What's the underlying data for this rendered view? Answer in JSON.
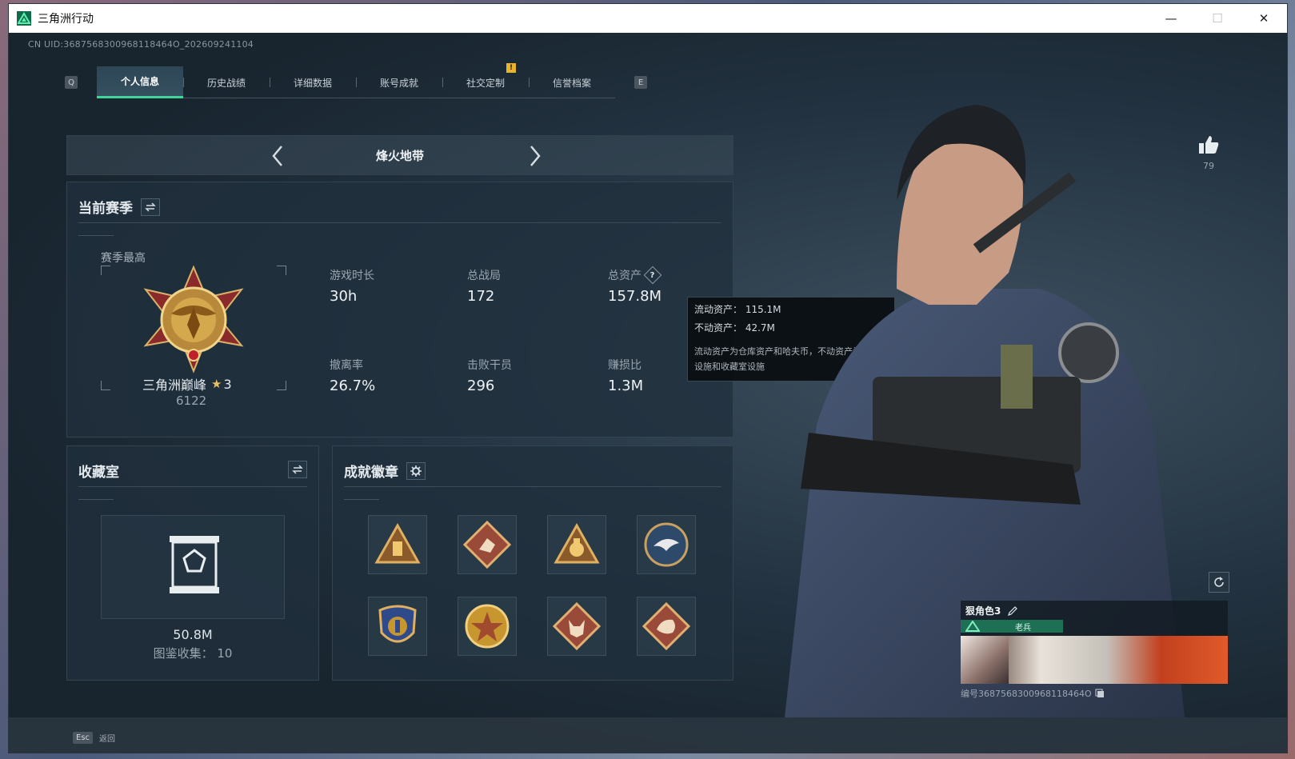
{
  "window": {
    "title": "三角洲行动",
    "minimize": "—",
    "maximize": "☐",
    "close": "✕"
  },
  "uid": "CN UID:3687568300968118464O_202609241104",
  "watermark": "",
  "tabs": {
    "prev_key": "Q",
    "next_key": "E",
    "badge": "!",
    "items": [
      {
        "label": "个人信息"
      },
      {
        "label": "历史战绩"
      },
      {
        "label": "详细数据"
      },
      {
        "label": "账号成就"
      },
      {
        "label": "社交定制"
      },
      {
        "label": "信誉档案"
      }
    ]
  },
  "mode": {
    "title": "烽火地带"
  },
  "season": {
    "title": "当前赛季",
    "best_label": "赛季最高",
    "rank_name": "三角洲巅峰",
    "rank_stars": "3",
    "rank_points": "6122",
    "stats": [
      {
        "label": "游戏时长",
        "value": "30h"
      },
      {
        "label": "总战局",
        "value": "172"
      },
      {
        "label": "总资产",
        "value": "157.8M"
      },
      {
        "label": "撤离率",
        "value": "26.7%"
      },
      {
        "label": "击败干员",
        "value": "296"
      },
      {
        "label": "赚损比",
        "value": "1.3M"
      }
    ]
  },
  "tooltip": {
    "liquid": "流动资产：  115.1M",
    "fixed": "不动资产：  42.7M",
    "desc": "流动资产为仓库资产和哈夫币，不动资产为特勤处设施和收藏室设施"
  },
  "collection": {
    "title": "收藏室",
    "value": "50.8M",
    "count": "图鉴收集：  10"
  },
  "badges": {
    "title": "成就徽章",
    "items": [
      {
        "icon": "triangle-vault-badge-icon",
        "color": "#8a5a2a"
      },
      {
        "icon": "runner-diamond-badge-icon",
        "color": "#9a4a38"
      },
      {
        "icon": "moneybag-triangle-badge-icon",
        "color": "#8a5a2a"
      },
      {
        "icon": "eagle-round-badge-icon",
        "color": "#2e4a6a"
      },
      {
        "icon": "police-shield-badge-icon",
        "color": "#2e4a8a"
      },
      {
        "icon": "star-medal-badge-icon",
        "color": "#a04a2e"
      },
      {
        "icon": "wolf-diamond-badge-icon",
        "color": "#9a4a38"
      },
      {
        "icon": "dragon-diamond-badge-icon",
        "color": "#9a4a38"
      }
    ]
  },
  "like": {
    "count": "79"
  },
  "namecard": {
    "name": "狠角色3",
    "rank": "老兵",
    "id": "编号3687568300968118464O"
  },
  "footer": {
    "esc_key": "Esc",
    "back_label": "返回"
  },
  "colors": {
    "accent": "#3fd49a",
    "panel": "#20303c",
    "background": "#18242e"
  }
}
